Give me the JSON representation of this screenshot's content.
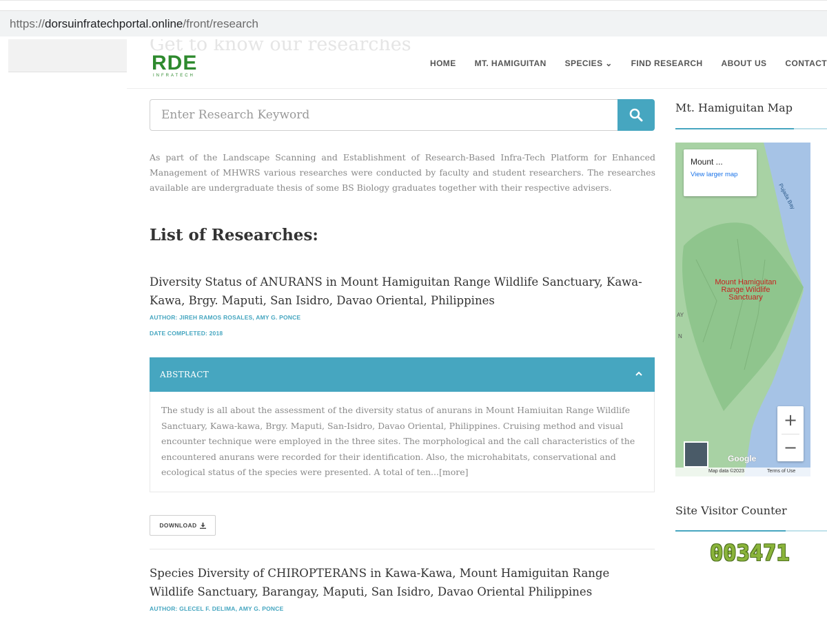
{
  "browser": {
    "url_scheme": "https://",
    "url_host": "dorsuinfratechportal.online",
    "url_path": "/front/research"
  },
  "header": {
    "ghost_heading": "Get to know our researches",
    "logo_text": "RDE",
    "logo_sub": "INFRATECH",
    "nav": [
      "HOME",
      "MT. HAMIGUITAN",
      "SPECIES ⌄",
      "FIND RESEARCH",
      "ABOUT US",
      "CONTACT US"
    ]
  },
  "search": {
    "placeholder": "Enter Research Keyword",
    "icon": "search-icon"
  },
  "intro": "As part of the Landscape Scanning and Establishment of Research-Based Infra-Tech Platform for Enhanced Management of MHWRS various researches were conducted by faculty and student researchers. The researches available are undergraduate thesis of some BS Biology graduates together with their respective advisers.",
  "list_title": "List of Researches:",
  "researches": [
    {
      "title": "Diversity Status of ANURANS in Mount Hamiguitan Range Wildlife Sanctuary, Kawa-Kawa, Brgy. Maputi, San Isidro, Davao Oriental, Philippines",
      "author": "AUTHOR: JIREH RAMOS ROSALES, AMY G. PONCE",
      "date": "DATE COMPLETED: 2018",
      "abstract_label": "ABSTRACT",
      "abstract": " The study is all about the assessment of the diversity status of anurans in Mount Hamiuitan Range Wildlife Sanctuary, Kawa-kawa, Brgy. Maputi, San-Isidro, Davao Oriental, Philippines. Cruising method and visual encounter technique were employed in the three sites. The morphological and the call characteristics of the encountered anurans were recorded for their identification. Also, the microhabitats, conservational and ecological status of the species were presented. A total of ten...",
      "more": "[more]",
      "download_label": "DOWNLOAD"
    },
    {
      "title": "Species Diversity of CHIROPTERANS in Kawa-Kawa, Mount Hamiguitan Range Wildlife Sanctuary, Barangay, Maputi, San Isidro, Davao Oriental Philippines",
      "author": "AUTHOR: GLECEL F. DELIMA, AMY G. PONCE"
    }
  ],
  "sidebar": {
    "map_title": "Mt. Hamiguitan Map",
    "map": {
      "card_name": "Mount ...",
      "card_link": "View larger map",
      "place_label": "Mount Hamiguitan Range Wildlife Sanctuary",
      "bay_label": "Pujada Bay",
      "google": "Google",
      "map_data": "Map data ©2023",
      "terms": "Terms of Use",
      "edge_ay": "AY",
      "edge_n": "N"
    },
    "counter_title": "Site Visitor Counter",
    "counter_value": "003471"
  },
  "colors": {
    "accent": "#46a6c0",
    "logo_green": "#2e8a2e",
    "counter_green": "#8ab43a"
  }
}
